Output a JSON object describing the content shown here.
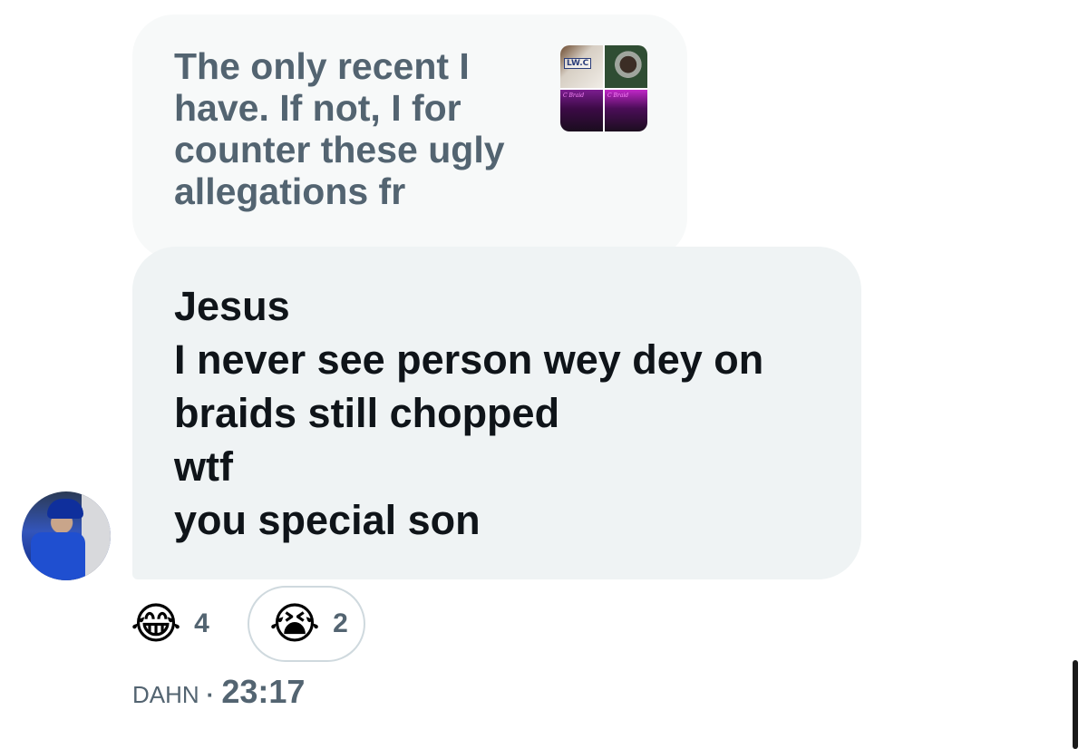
{
  "reply": {
    "text": "The only recent I have. If not, I for counter these ugly allegations fr",
    "thumbnail_caption": "LW.C",
    "thumbnail_neon_left": "C Braid",
    "thumbnail_neon_right": "C Braid"
  },
  "message": {
    "lines": [
      "Jesus",
      "I never see person wey dey on",
      "braids still chopped",
      "wtf",
      "you special son"
    ]
  },
  "reactions": [
    {
      "emoji": "😂",
      "count": "4",
      "selected": false
    },
    {
      "emoji": "😭",
      "count": "2",
      "selected": true
    }
  ],
  "meta": {
    "sender": "DAHN",
    "separator": "·",
    "time": "23:17"
  },
  "icons": {
    "avatar": "user-avatar",
    "thumbnail": "image-thumbnail"
  }
}
